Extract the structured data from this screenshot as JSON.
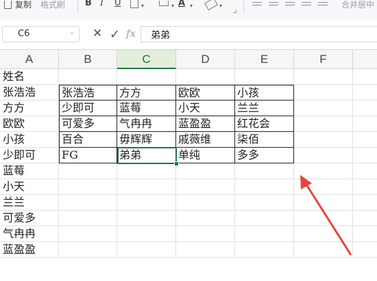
{
  "ribbon": {
    "copy_label": "复制",
    "format_painter_label": "格式刷",
    "bold_label": "B",
    "italic_label": "I",
    "underline_label": "U",
    "font_color_label": "A",
    "merge_label": "合并居中"
  },
  "formula_bar": {
    "name_box": "C6",
    "cancel_label": "✕",
    "confirm_label": "✓",
    "fx_label": "fx",
    "content": "弟弟"
  },
  "columns": [
    "A",
    "B",
    "C",
    "D",
    "E",
    "F"
  ],
  "selected_column": "C",
  "col_a_values": [
    "姓名",
    "张浩浩",
    "方方",
    "欧欧",
    "小孩",
    "少即可",
    "蓝莓",
    "小天",
    "兰兰",
    "可爱多",
    "气冉冉",
    "蓝盈盈"
  ],
  "table": [
    [
      "张浩浩",
      "方方",
      "欧欧",
      "小孩"
    ],
    [
      "少即可",
      "蓝莓",
      "小天",
      "兰兰"
    ],
    [
      "可爱多",
      "气冉冉",
      "蓝盈盈",
      "红花会"
    ],
    [
      "百合",
      "毋辉辉",
      "戚薇维",
      "柒佰"
    ],
    [
      "FG",
      "弟弟",
      "单纯",
      "多多"
    ]
  ],
  "colors": {
    "accent": "#217346",
    "arrow": "#e8453c",
    "grid_line": "#e1e1e1",
    "header_bg": "#f5f6f7"
  }
}
